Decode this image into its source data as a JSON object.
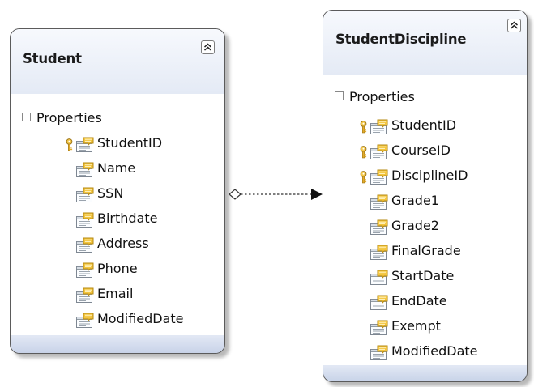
{
  "diagram": {
    "entities": [
      {
        "id": "student",
        "title": "Student",
        "section_label": "Properties",
        "collapse_icon": "double-chevron-up-icon",
        "properties": [
          {
            "name": "StudentID",
            "key": true
          },
          {
            "name": "Name",
            "key": false
          },
          {
            "name": "SSN",
            "key": false
          },
          {
            "name": "Birthdate",
            "key": false
          },
          {
            "name": "Address",
            "key": false
          },
          {
            "name": "Phone",
            "key": false
          },
          {
            "name": "Email",
            "key": false
          },
          {
            "name": "ModifiedDate",
            "key": false
          }
        ]
      },
      {
        "id": "student-discipline",
        "title": "StudentDiscipline",
        "section_label": "Properties",
        "collapse_icon": "double-chevron-up-icon",
        "properties": [
          {
            "name": "StudentID",
            "key": true
          },
          {
            "name": "CourseID",
            "key": true
          },
          {
            "name": "DisciplineID",
            "key": true
          },
          {
            "name": "Grade1",
            "key": false
          },
          {
            "name": "Grade2",
            "key": false
          },
          {
            "name": "FinalGrade",
            "key": false
          },
          {
            "name": "StartDate",
            "key": false
          },
          {
            "name": "EndDate",
            "key": false
          },
          {
            "name": "Exempt",
            "key": false
          },
          {
            "name": "ModifiedDate",
            "key": false
          }
        ]
      }
    ],
    "association": {
      "from": "Student",
      "to": "StudentDiscipline",
      "start_marker": "hollow-diamond",
      "end_marker": "filled-arrow",
      "line_style": "dashed"
    },
    "colors": {
      "header": "#e4eaf5",
      "footer": "#c8d3e8",
      "border": "#5b5b5b",
      "key": "#d9a521",
      "property_icon": "#f0c640"
    }
  }
}
